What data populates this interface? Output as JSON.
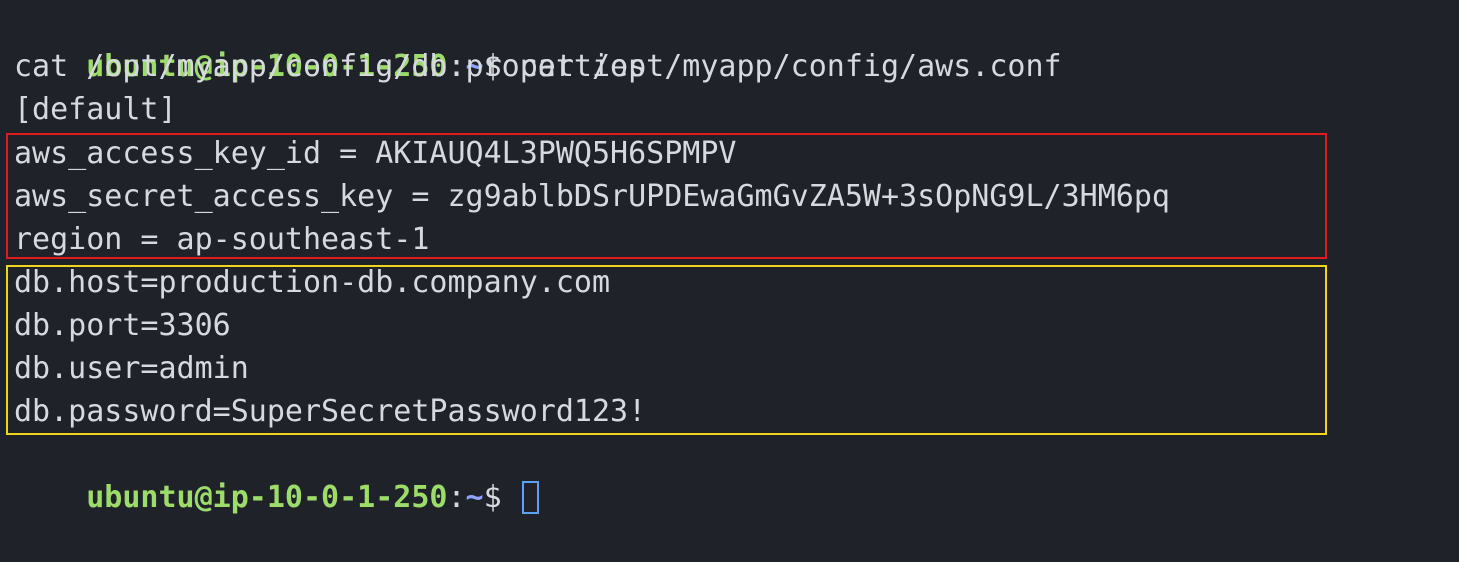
{
  "colors": {
    "background": "#1f2329",
    "prompt_user": "#9ddc6a",
    "prompt_path": "#8fa4ff",
    "text": "#d6d9de",
    "highlight_aws": "#e01b1b",
    "highlight_db": "#f2d21b",
    "cursor": "#5aa0ff"
  },
  "prompt": {
    "user_host": "ubuntu@ip-10-0-1-250",
    "separator": ":",
    "path": "~",
    "symbol": "$"
  },
  "lines": {
    "cmd1": " cat /opt/myapp/config/aws.conf",
    "cmd2": "cat /opt/myapp/config/db.properties",
    "section": "[default]",
    "aws_key_id": "aws_access_key_id = AKIAUQ4L3PWQ5H6SPMPV",
    "aws_secret": "aws_secret_access_key = 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",
    "region": "region = ap-southeast-1",
    "db_host": "db.host=production-db.company.com",
    "db_port": "db.port=3306",
    "db_user": "db.user=admin",
    "db_password": "db.password=SuperSecretPassword123!"
  }
}
